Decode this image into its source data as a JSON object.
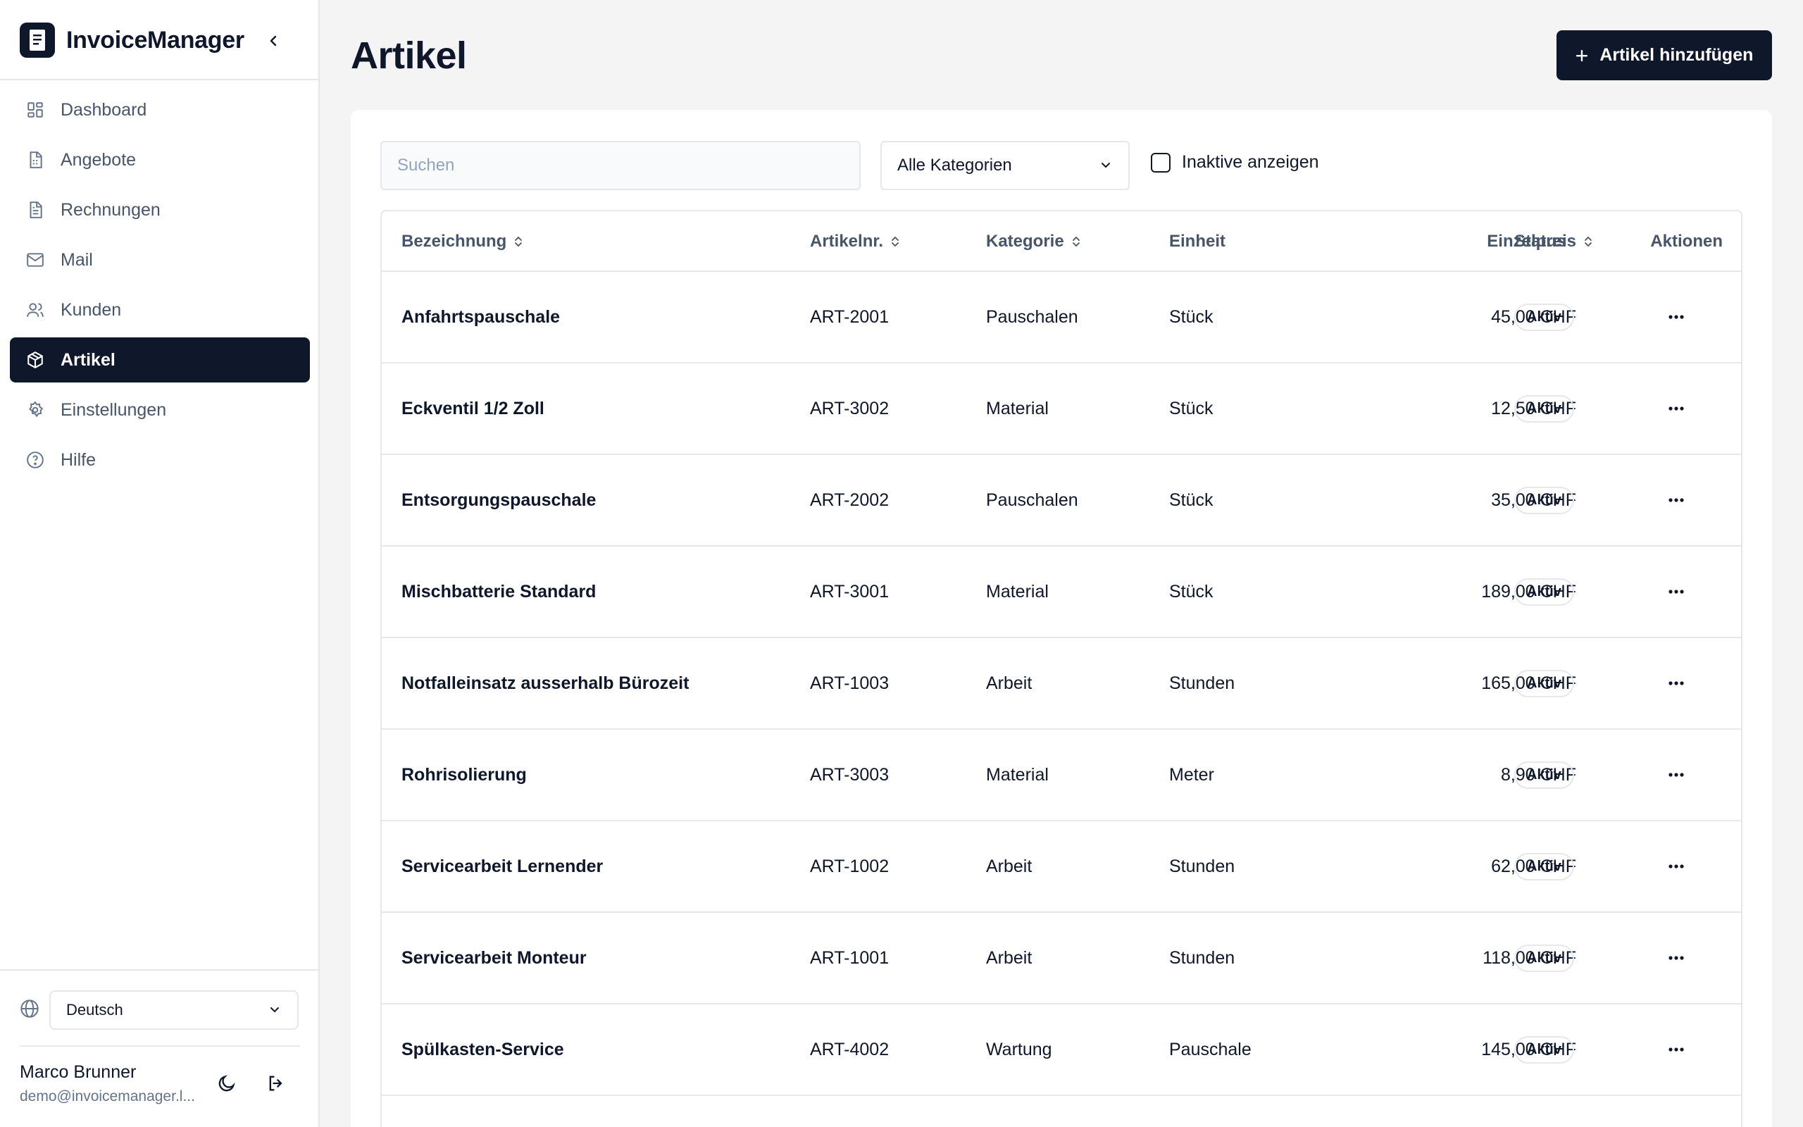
{
  "app": {
    "name": "InvoiceManager"
  },
  "sidebar": {
    "items": [
      {
        "label": "Dashboard",
        "icon": "dashboard-icon",
        "active": false
      },
      {
        "label": "Angebote",
        "icon": "document-icon",
        "active": false
      },
      {
        "label": "Rechnungen",
        "icon": "invoice-icon",
        "active": false
      },
      {
        "label": "Mail",
        "icon": "mail-icon",
        "active": false
      },
      {
        "label": "Kunden",
        "icon": "users-icon",
        "active": false
      },
      {
        "label": "Artikel",
        "icon": "package-icon",
        "active": true
      },
      {
        "label": "Einstellungen",
        "icon": "gear-icon",
        "active": false
      },
      {
        "label": "Hilfe",
        "icon": "help-icon",
        "active": false
      }
    ],
    "language": "Deutsch",
    "user": {
      "name": "Marco Brunner",
      "email": "demo@invoicemanager.l..."
    }
  },
  "page": {
    "title": "Artikel",
    "add_button": "Artikel hinzufügen"
  },
  "filters": {
    "search_placeholder": "Suchen",
    "category": "Alle Kategorien",
    "show_inactive": "Inaktive anzeigen"
  },
  "table": {
    "columns": {
      "name": "Bezeichnung",
      "number": "Artikelnr.",
      "category": "Kategorie",
      "unit": "Einheit",
      "price": "Einzelpreis",
      "status": "Status",
      "actions": "Aktionen"
    },
    "rows": [
      {
        "name": "Anfahrtspauschale",
        "number": "ART-2001",
        "category": "Pauschalen",
        "unit": "Stück",
        "price": "45,00 CHF",
        "status": "Aktiv"
      },
      {
        "name": "Eckventil 1/2 Zoll",
        "number": "ART-3002",
        "category": "Material",
        "unit": "Stück",
        "price": "12,50 CHF",
        "status": "Aktiv"
      },
      {
        "name": "Entsorgungspauschale",
        "number": "ART-2002",
        "category": "Pauschalen",
        "unit": "Stück",
        "price": "35,00 CHF",
        "status": "Aktiv"
      },
      {
        "name": "Mischbatterie Standard",
        "number": "ART-3001",
        "category": "Material",
        "unit": "Stück",
        "price": "189,00 CHF",
        "status": "Aktiv"
      },
      {
        "name": "Notfalleinsatz ausserhalb Bürozeit",
        "number": "ART-1003",
        "category": "Arbeit",
        "unit": "Stunden",
        "price": "165,00 CHF",
        "status": "Aktiv"
      },
      {
        "name": "Rohrisolierung",
        "number": "ART-3003",
        "category": "Material",
        "unit": "Meter",
        "price": "8,90 CHF",
        "status": "Aktiv"
      },
      {
        "name": "Servicearbeit Lernender",
        "number": "ART-1002",
        "category": "Arbeit",
        "unit": "Stunden",
        "price": "62,00 CHF",
        "status": "Aktiv"
      },
      {
        "name": "Servicearbeit Monteur",
        "number": "ART-1001",
        "category": "Arbeit",
        "unit": "Stunden",
        "price": "118,00 CHF",
        "status": "Aktiv"
      },
      {
        "name": "Spülkasten-Service",
        "number": "ART-4002",
        "category": "Wartung",
        "unit": "Pauschale",
        "price": "145,00 CHF",
        "status": "Aktiv"
      }
    ]
  }
}
